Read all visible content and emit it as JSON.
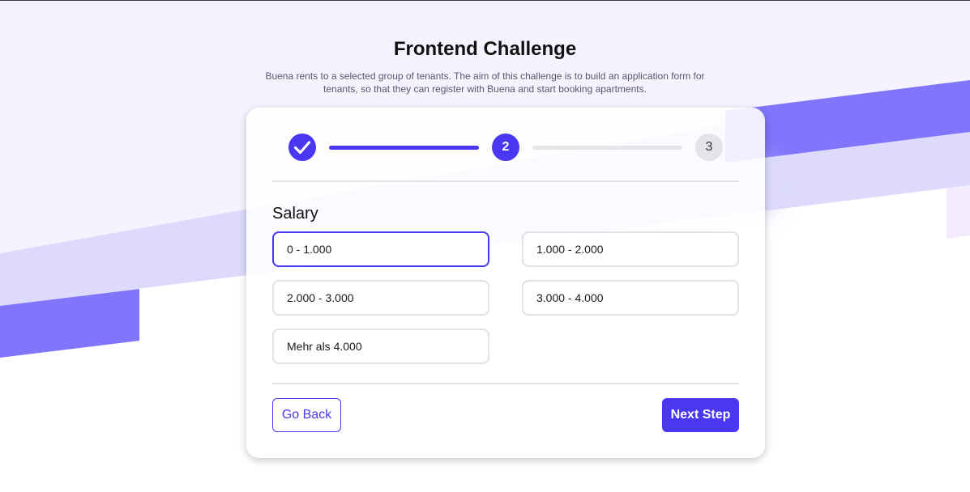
{
  "header": {
    "title": "Frontend Challenge",
    "subtitle": "Buena rents to a selected group of tenants. The aim of this challenge is to build an application form for tenants, so that they can register with Buena and start booking apartments."
  },
  "stepper": {
    "steps": [
      {
        "label": "",
        "state": "completed",
        "icon": "check-icon"
      },
      {
        "label": "2",
        "state": "active"
      },
      {
        "label": "3",
        "state": "pending"
      }
    ],
    "connectors": [
      {
        "state": "completed"
      },
      {
        "state": "pending"
      }
    ]
  },
  "form": {
    "section_title": "Salary",
    "selected_option": "0 - 1.000",
    "options": [
      {
        "label": "0 - 1.000",
        "selected": true
      },
      {
        "label": "1.000 - 2.000",
        "selected": false
      },
      {
        "label": "2.000 - 3.000",
        "selected": false
      },
      {
        "label": "3.000 - 4.000",
        "selected": false
      },
      {
        "label": "Mehr als 4.000",
        "selected": false
      }
    ]
  },
  "actions": {
    "back_label": "Go Back",
    "next_label": "Next Step"
  },
  "colors": {
    "accent": "#4a37f2",
    "accent_light": "#dddafc",
    "background_tint": "#f5f3ff",
    "border": "#e2e2e6"
  }
}
